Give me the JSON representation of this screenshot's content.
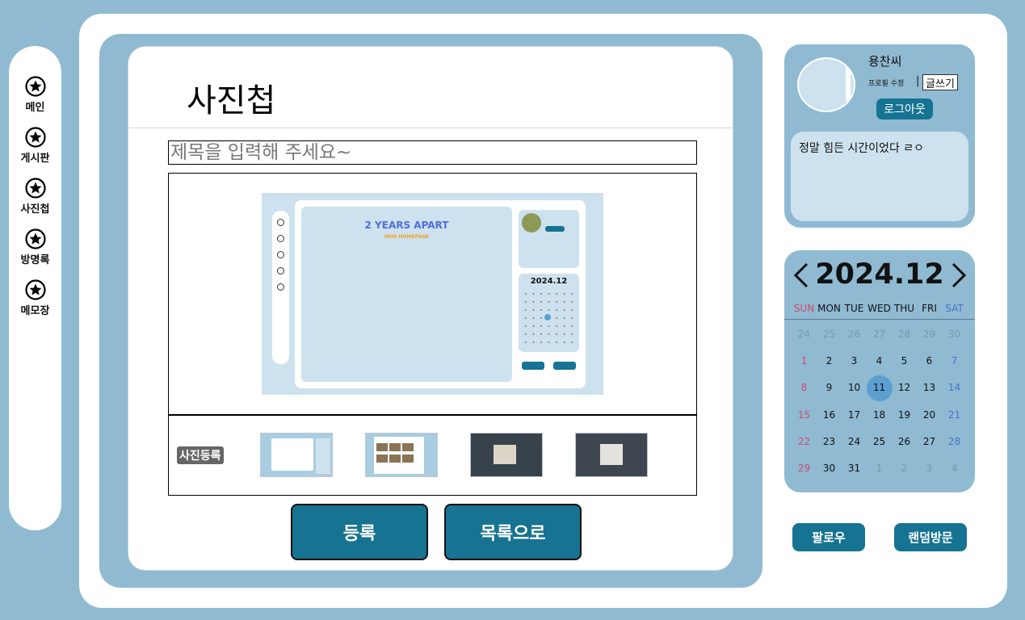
{
  "nav": {
    "items": [
      {
        "label": "메인",
        "icon": "star-icon"
      },
      {
        "label": "게시판",
        "icon": "star-icon"
      },
      {
        "label": "사진첩",
        "icon": "star-icon"
      },
      {
        "label": "방명록",
        "icon": "star-icon"
      },
      {
        "label": "메모장",
        "icon": "star-icon"
      }
    ]
  },
  "page": {
    "title": "사진첩",
    "title_placeholder": "제목을 입력해 주세요~",
    "upload_label": "사진등록",
    "submit_label": "등록",
    "list_label": "목록으로"
  },
  "preview": {
    "headline": "2 YEARS APART",
    "subheadline": "MINI HOMEPAGE",
    "calendar_title": "2024.12"
  },
  "profile": {
    "name": "용찬씨",
    "edit_label": "프로필 수정",
    "separator": "|",
    "write_label": "글쓰기",
    "logout_label": "로그아웃",
    "status_message": "정말 힘든 시간이었다 ㄹㅇ"
  },
  "calendar": {
    "title": "2024.12",
    "weekdays": [
      "SUN",
      "MON",
      "TUE",
      "WED",
      "THU",
      "FRI",
      "SAT"
    ],
    "weeks": [
      [
        "24",
        "25",
        "26",
        "27",
        "28",
        "29",
        "30"
      ],
      [
        "1",
        "2",
        "3",
        "4",
        "5",
        "6",
        "7"
      ],
      [
        "8",
        "9",
        "10",
        "11",
        "12",
        "13",
        "14"
      ],
      [
        "15",
        "16",
        "17",
        "18",
        "19",
        "20",
        "21"
      ],
      [
        "22",
        "23",
        "24",
        "25",
        "26",
        "27",
        "28"
      ],
      [
        "29",
        "30",
        "31",
        "1",
        "2",
        "3",
        "4"
      ]
    ],
    "today": "11"
  },
  "actions": {
    "follow_label": "팔로우",
    "random_visit_label": "랜덤방문"
  },
  "colors": {
    "background": "#8fbad2",
    "accent": "#167391",
    "today": "#5b9fd0",
    "sunday": "#d24a6c",
    "saturday": "#4a72c9"
  }
}
